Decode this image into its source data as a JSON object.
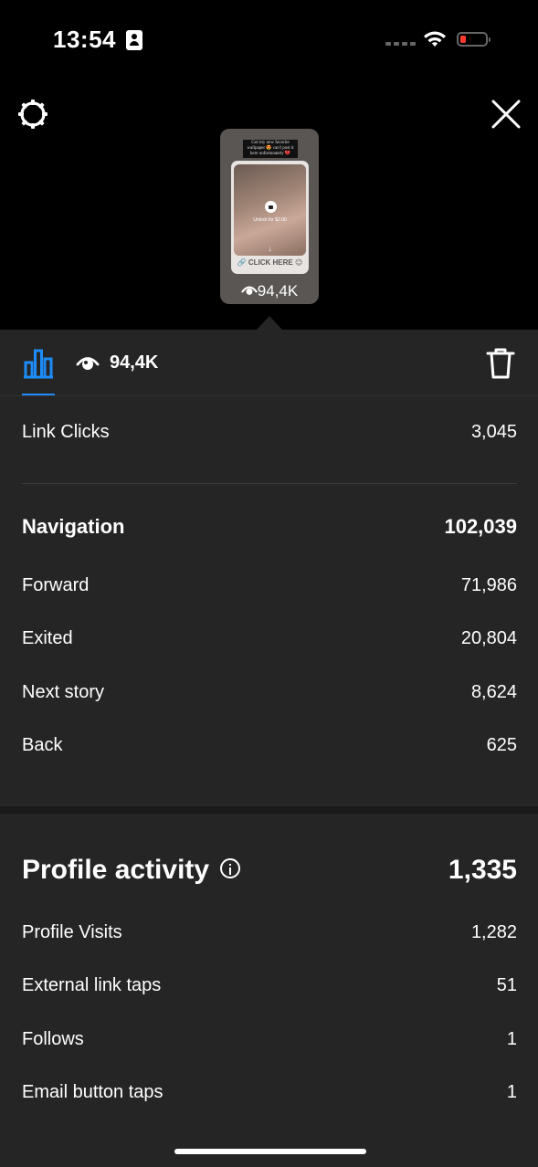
{
  "status": {
    "time": "13:54"
  },
  "preview": {
    "caption": "Got my new favorite wallpaper 😍 can't post it here unfortunately 💔",
    "unlock_text": "Unlock for $2.00",
    "arrow": "↓",
    "click_here": "🔗 CLICK HERE 😉",
    "views": "94,4K"
  },
  "tabs": {
    "views": "94,4K"
  },
  "link_clicks": {
    "label": "Link Clicks",
    "value": "3,045"
  },
  "navigation": {
    "title": "Navigation",
    "total": "102,039",
    "items": [
      {
        "label": "Forward",
        "value": "71,986"
      },
      {
        "label": "Exited",
        "value": "20,804"
      },
      {
        "label": "Next story",
        "value": "8,624"
      },
      {
        "label": "Back",
        "value": "625"
      }
    ]
  },
  "profile_activity": {
    "title": "Profile activity",
    "total": "1,335",
    "items": [
      {
        "label": "Profile Visits",
        "value": "1,282"
      },
      {
        "label": "External link taps",
        "value": "51"
      },
      {
        "label": "Follows",
        "value": "1"
      },
      {
        "label": "Email button taps",
        "value": "1"
      }
    ]
  },
  "colors": {
    "accent": "#1d8cf8",
    "panel": "#252525",
    "battery_low": "#ff3b30"
  },
  "icons": [
    "settings-gear-icon",
    "close-icon",
    "insights-bar-chart-icon",
    "eye-icon",
    "trash-icon",
    "info-icon",
    "wifi-icon",
    "battery-icon"
  ]
}
